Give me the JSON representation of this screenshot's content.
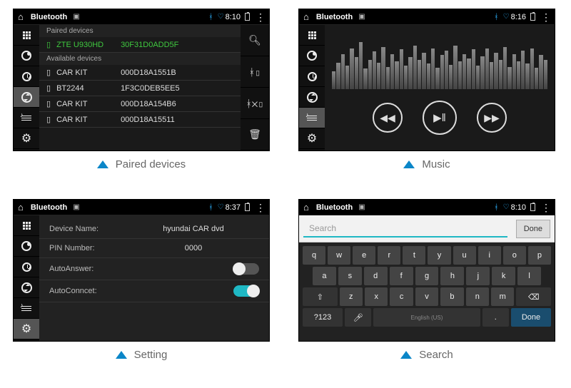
{
  "screens": {
    "paired": {
      "title": "Bluetooth",
      "time": "8:10",
      "section_paired": "Paired devices",
      "section_available": "Available devices",
      "paired_device": {
        "name": "ZTE U930HD",
        "mac": "30F31D0ADD5F"
      },
      "available": [
        {
          "name": "CAR KIT",
          "mac": "000D18A1551B"
        },
        {
          "name": "BT2244",
          "mac": "1F3C0DEB5EE5"
        },
        {
          "name": "CAR KIT",
          "mac": "000D18A154B6"
        },
        {
          "name": "CAR KIT",
          "mac": "000D18A15511"
        }
      ],
      "caption": "Paired devices"
    },
    "music": {
      "title": "Bluetooth",
      "time": "8:16",
      "caption": "Music"
    },
    "setting": {
      "title": "Bluetooth",
      "time": "8:37",
      "device_name_label": "Device Name:",
      "device_name_value": "hyundai CAR dvd",
      "pin_label": "PIN Number:",
      "pin_value": "0000",
      "autoanswer_label": "AutoAnswer:",
      "autoconnect_label": "AutoConncet:",
      "caption": "Setting"
    },
    "search": {
      "title": "Bluetooth",
      "time": "8:10",
      "placeholder": "Search",
      "done": "Done",
      "kb_done": "Done",
      "kb_hint": "English (US)",
      "sym": "?123",
      "caption": "Search"
    }
  }
}
